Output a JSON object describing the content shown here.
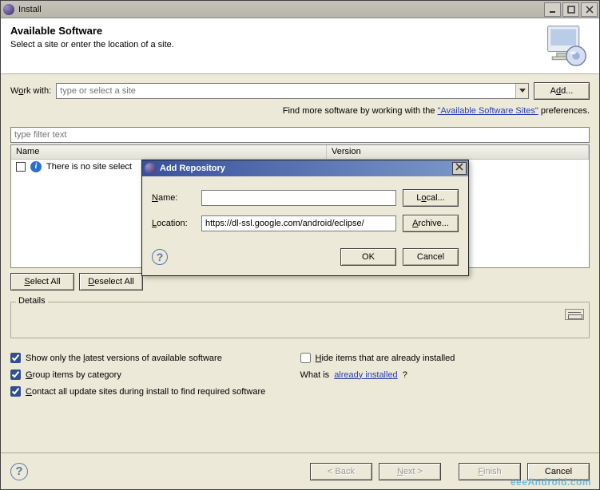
{
  "window": {
    "title": "Install"
  },
  "header": {
    "title": "Available Software",
    "subtitle": "Select a site or enter the location of a site."
  },
  "workwith": {
    "label_pre": "W",
    "label_u": "o",
    "label_post": "rk with:",
    "placeholder": "type or select a site",
    "add_pre": "A",
    "add_u": "d",
    "add_post": "d..."
  },
  "findmore": {
    "prefix": "Find more software by working with the ",
    "link": "\"Available Software Sites\"",
    "suffix": " preferences."
  },
  "filter": {
    "placeholder": "type filter text"
  },
  "table": {
    "col1": "Name",
    "col2": "Version",
    "empty_row": "There is no site select"
  },
  "selbtns": {
    "select_pre": "",
    "select_u": "S",
    "select_post": "elect All",
    "deselect_pre": "",
    "deselect_u": "D",
    "deselect_post": "eselect All"
  },
  "details": {
    "label": "Details"
  },
  "opts": {
    "o1_pre": "Show only the ",
    "o1_u": "l",
    "o1_post": "atest versions of available software",
    "o2_pre": "",
    "o2_u": "H",
    "o2_post": "ide items that are already installed",
    "o3_pre": "",
    "o3_u": "G",
    "o3_post": "roup items by category",
    "whatis_prefix": "What is ",
    "whatis_link": "already installed",
    "whatis_suffix": "?",
    "o4_pre": "",
    "o4_u": "C",
    "o4_post": "ontact all update sites during install to find required software"
  },
  "wiz": {
    "back": "< Back",
    "next_pre": "",
    "next_u": "N",
    "next_post": "ext >",
    "finish_pre": "",
    "finish_u": "F",
    "finish_post": "inish",
    "cancel": "Cancel"
  },
  "modal": {
    "title": "Add Repository",
    "name_pre": "",
    "name_u": "N",
    "name_post": "ame:",
    "name_val": "",
    "loc_pre": "",
    "loc_u": "L",
    "loc_post": "ocation:",
    "loc_val": "https://dl-ssl.google.com/android/eclipse/",
    "local_pre": "L",
    "local_u": "o",
    "local_post": "cal...",
    "archive_pre": "",
    "archive_u": "A",
    "archive_post": "rchive...",
    "ok": "OK",
    "cancel": "Cancel"
  },
  "watermark": "eeeAndroid.com"
}
